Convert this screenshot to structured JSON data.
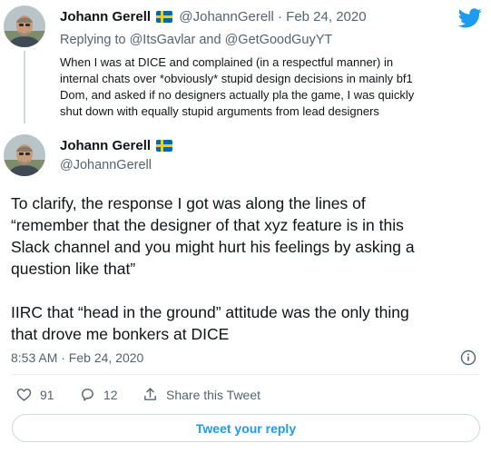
{
  "parent_tweet": {
    "author_name": "Johann Gerell",
    "handle": "@JohannGerell",
    "separator": "·",
    "date": "Feb 24, 2020",
    "replying_prefix": "Replying to",
    "replying_to_1": "@ItsGavlar",
    "replying_and": "and",
    "replying_to_2": "@GetGoodGuyYT",
    "text_line_1": "When I was at DICE and complained (in a respectful manner) in",
    "text_line_2": "internal chats over *obviously* stupid design decisions in mainly bf1",
    "text_line_3": "Dom, and asked if no designers actually pla the game, I was quickly",
    "text_line_4": "shut down with equally stupid arguments from lead designers"
  },
  "main_tweet": {
    "author_name": "Johann Gerell",
    "handle": "@JohannGerell",
    "paragraph_1_line_1": "To clarify, the response I got was along the lines of",
    "paragraph_1_line_2": "“remember that the designer of that xyz feature is in this",
    "paragraph_1_line_3": "Slack channel and you might hurt his feelings by asking a",
    "paragraph_1_line_4": "question like that”",
    "paragraph_2_line_1": "IIRC that “head in the ground” attitude was the only thing",
    "paragraph_2_line_2": "that drove me bonkers at DICE",
    "timestamp": "8:53 AM · Feb 24, 2020"
  },
  "actions": {
    "likes_count": "91",
    "replies_count": "12",
    "share_label": "Share this Tweet"
  },
  "reply_button_label": "Tweet your reply",
  "icons": {
    "brand": "twitter-bird-icon",
    "flag": "sweden-flag-icon",
    "info": "info-icon",
    "like": "heart-icon",
    "reply": "comment-icon",
    "share": "share-icon"
  },
  "colors": {
    "brand_blue": "#1d9bf0",
    "text_primary": "#0f1419",
    "text_secondary": "#536471",
    "border": "#cfd9de",
    "flag_blue": "#006aa7",
    "flag_yellow": "#fecc00"
  }
}
